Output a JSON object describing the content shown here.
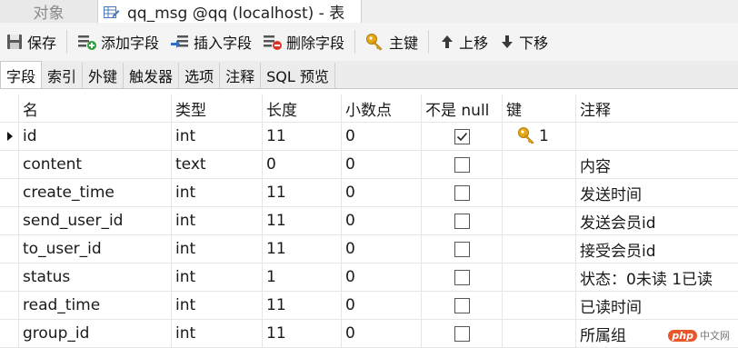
{
  "window_tabs": [
    {
      "label": "对象",
      "active": false
    },
    {
      "label": "qq_msg @qq (localhost) - 表",
      "active": true
    }
  ],
  "toolbar": {
    "save": "保存",
    "add_field": "添加字段",
    "insert_field": "插入字段",
    "delete_field": "删除字段",
    "primary_key": "主键",
    "move_up": "上移",
    "move_down": "下移"
  },
  "subtabs": [
    "字段",
    "索引",
    "外键",
    "触发器",
    "选项",
    "注释",
    "SQL 预览"
  ],
  "columns": {
    "name": "名",
    "type": "类型",
    "length": "长度",
    "decimals": "小数点",
    "not_null": "不是 null",
    "key": "键",
    "comment": "注释"
  },
  "fields": [
    {
      "name": "id",
      "type": "int",
      "length": "11",
      "decimals": "0",
      "not_null": true,
      "key": "1",
      "comment": "",
      "selected": true
    },
    {
      "name": "content",
      "type": "text",
      "length": "0",
      "decimals": "0",
      "not_null": false,
      "key": "",
      "comment": "内容"
    },
    {
      "name": "create_time",
      "type": "int",
      "length": "11",
      "decimals": "0",
      "not_null": false,
      "key": "",
      "comment": "发送时间"
    },
    {
      "name": "send_user_id",
      "type": "int",
      "length": "11",
      "decimals": "0",
      "not_null": false,
      "key": "",
      "comment": "发送会员id"
    },
    {
      "name": "to_user_id",
      "type": "int",
      "length": "11",
      "decimals": "0",
      "not_null": false,
      "key": "",
      "comment": "接受会员id"
    },
    {
      "name": "status",
      "type": "int",
      "length": "1",
      "decimals": "0",
      "not_null": false,
      "key": "",
      "comment": "状态：0未读 1已读"
    },
    {
      "name": "read_time",
      "type": "int",
      "length": "11",
      "decimals": "0",
      "not_null": false,
      "key": "",
      "comment": "已读时间"
    },
    {
      "name": "group_id",
      "type": "int",
      "length": "11",
      "decimals": "0",
      "not_null": false,
      "key": "",
      "comment": "所属组"
    }
  ],
  "watermark": {
    "logo": "php",
    "text": "中文网"
  },
  "colors": {
    "key_gold": "#e6a817",
    "add_green": "#2e9e3a",
    "delete_red": "#d9362b",
    "insert_blue": "#2a6fc9"
  }
}
